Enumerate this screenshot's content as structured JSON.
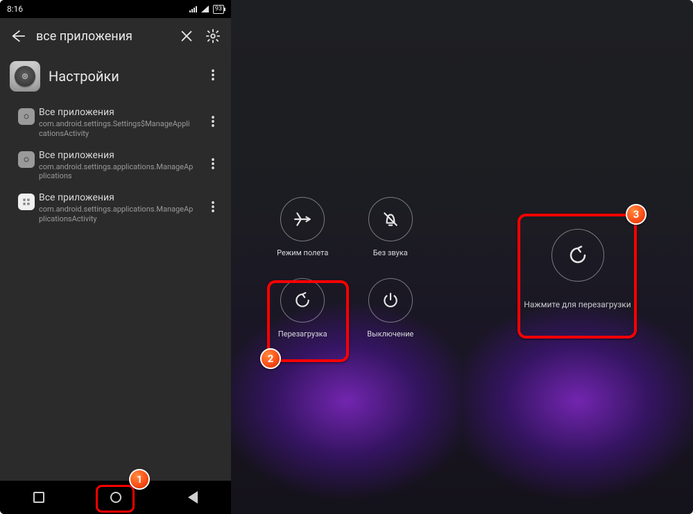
{
  "statusbar": {
    "time": "8:16",
    "battery": "93"
  },
  "toolbar": {
    "title": "все приложения"
  },
  "app": {
    "name": "Настройки"
  },
  "activities": [
    {
      "title": "Все приложения",
      "pkg": "com.android.settings.Settings$ManageApplicationsActivity"
    },
    {
      "title": "Все приложения",
      "pkg": "com.android.settings.applications.ManageApplications"
    },
    {
      "title": "Все приложения",
      "pkg": "com.android.settings.applications.ManageApplicationsActivity"
    }
  ],
  "power": {
    "airplane": "Режим полета",
    "silent": "Без звука",
    "reboot": "Перезагрузка",
    "poweroff": "Выключение"
  },
  "panel3": {
    "label": "Нажмите для перезагрузки"
  },
  "badges": {
    "b1": "1",
    "b2": "2",
    "b3": "3"
  }
}
